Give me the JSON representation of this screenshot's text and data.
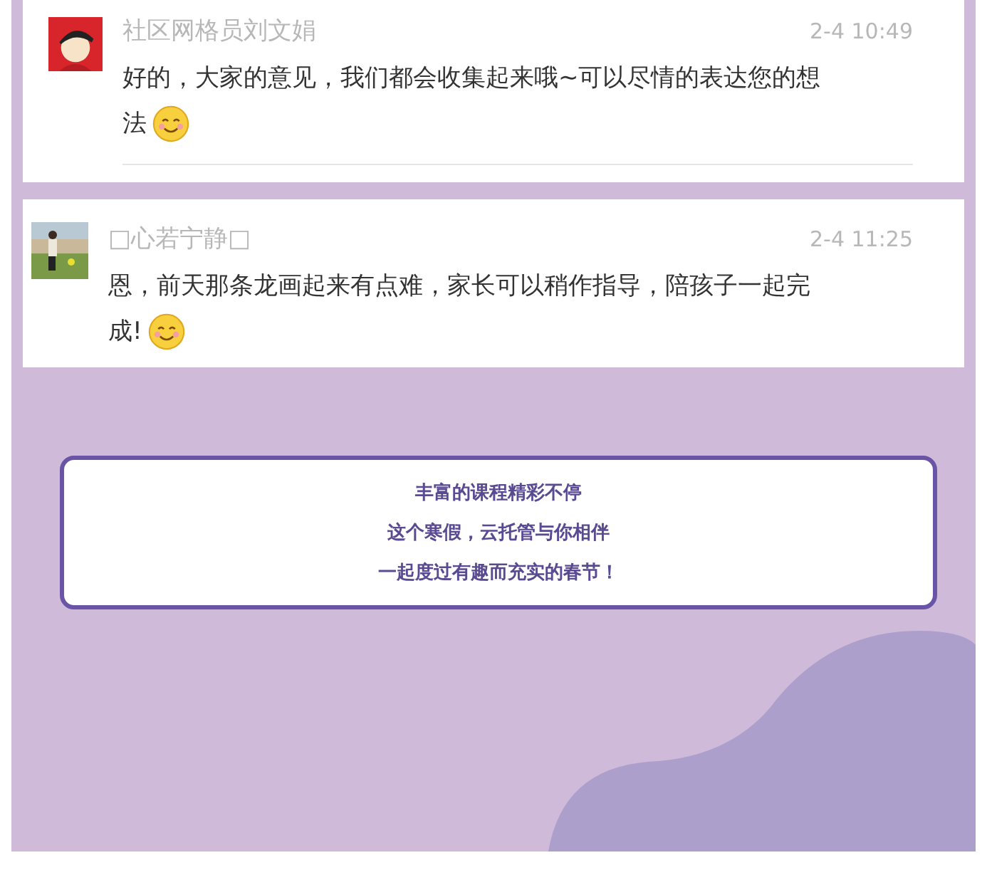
{
  "comments": [
    {
      "author": "社区网格员刘文娟",
      "time": "2-4 10:49",
      "text": "好的，大家的意见，我们都会收集起来哦~可以尽情的表达您的想法",
      "emoji": true,
      "avatar": {
        "kind": "cartoon"
      }
    },
    {
      "author": "□心若宁静□",
      "time": "2-4 11:25",
      "text": "恩，前天那条龙画起来有点难，家长可以稍作指导，陪孩子一起完成!",
      "emoji": true
    }
  ],
  "banner": {
    "lines": [
      "丰富的课程精彩不停",
      "这个寒假，云托管与你相伴",
      "一起度过有趣而充实的春节！"
    ]
  }
}
